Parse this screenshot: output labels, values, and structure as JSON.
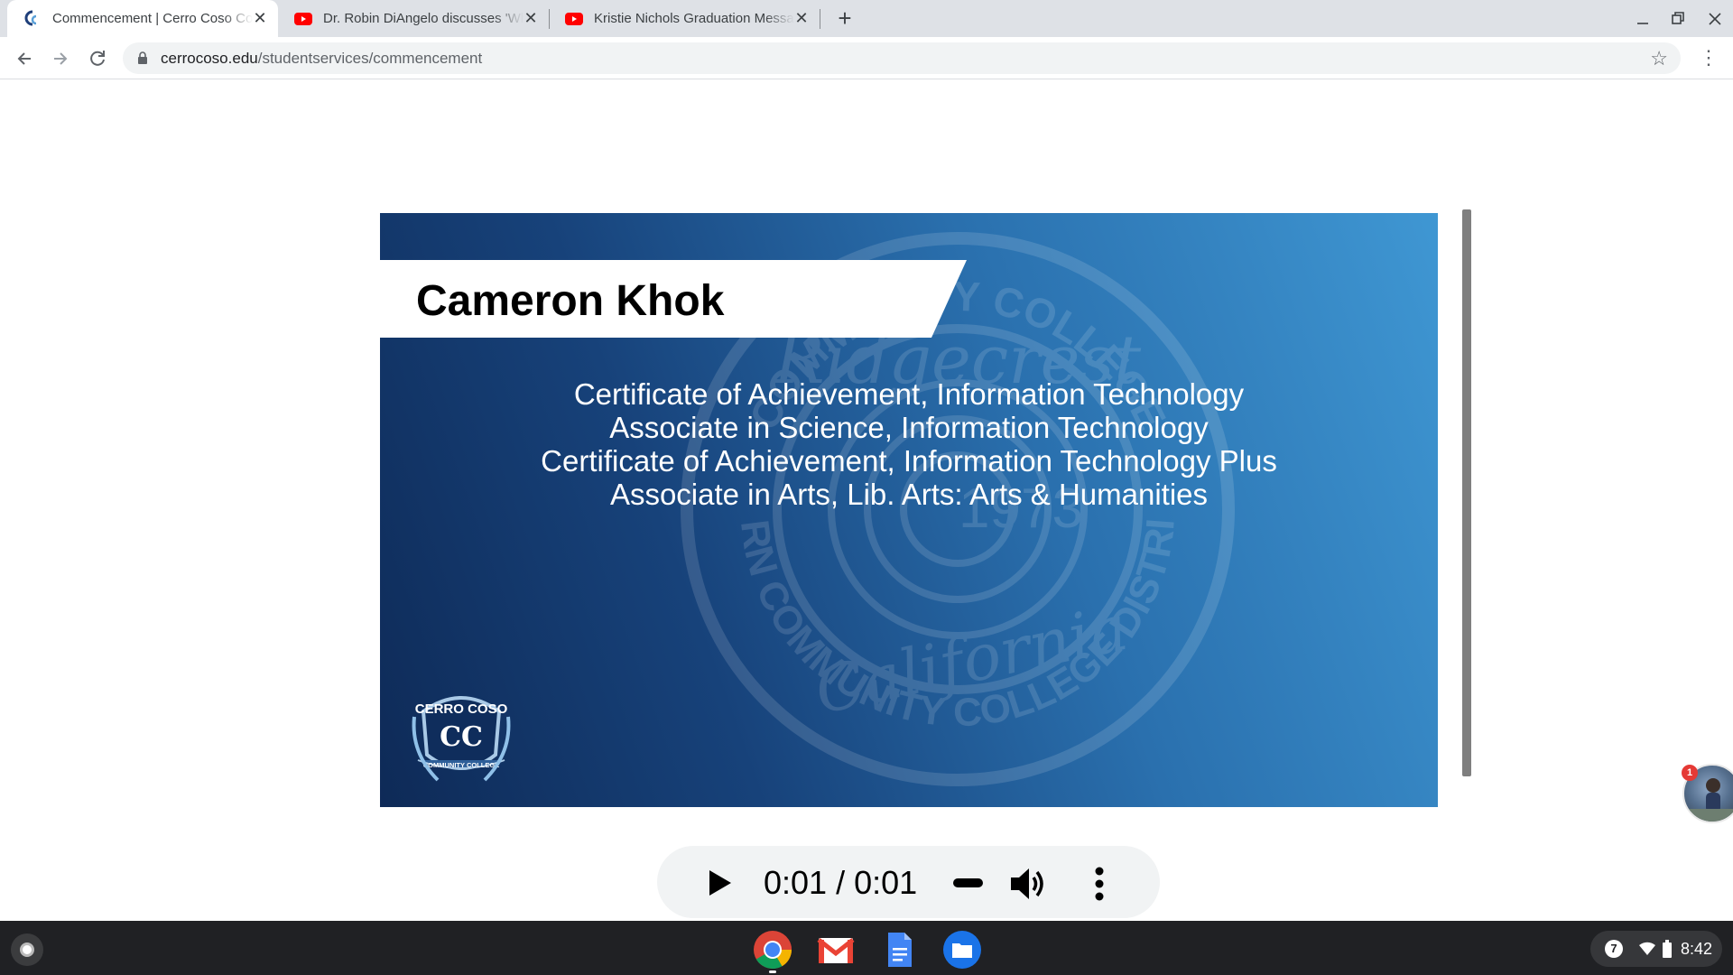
{
  "browser": {
    "tabs": [
      {
        "title": "Commencement | Cerro Coso Community College",
        "favicon": "cerro-coso-icon",
        "active": true
      },
      {
        "title": "Dr. Robin DiAngelo discusses 'White Fragility'",
        "favicon": "youtube-icon",
        "active": false
      },
      {
        "title": "Kristie Nichols Graduation Message",
        "favicon": "youtube-icon",
        "active": false
      }
    ],
    "url_host": "cerrocoso.edu",
    "url_path": "/studentservices/commencement"
  },
  "slide": {
    "name": "Cameron Khok",
    "degrees": [
      "Certificate of Achievement, Information Technology",
      "Associate in Science, Information Technology",
      "Certificate of Achievement, Information Technology Plus",
      "Associate in Arts, Lib. Arts: Arts & Humanities"
    ],
    "seal_text_top": "COMMUNITY COLLEGE",
    "seal_text_script": "Ridgecrest",
    "seal_year": "1973",
    "seal_text_bottom": "KERN COMMUNITY COLLEGE DISTRICT",
    "seal_state": "California",
    "logo_top": "CERRO COSO",
    "logo_initials": "CC",
    "logo_bottom": "COMMUNITY COLLEGE"
  },
  "audio": {
    "time": "0:01 / 0:01"
  },
  "bubble_badge": "1",
  "shelf": {
    "apps": [
      "chrome-icon",
      "gmail-icon",
      "docs-icon",
      "files-icon"
    ],
    "notification_count": "7",
    "clock": "8:42"
  },
  "colors": {
    "slide_dark": "#0e2a57",
    "slide_light": "#3f97d3",
    "tabstrip": "#dee1e6",
    "shelf": "#202124"
  }
}
